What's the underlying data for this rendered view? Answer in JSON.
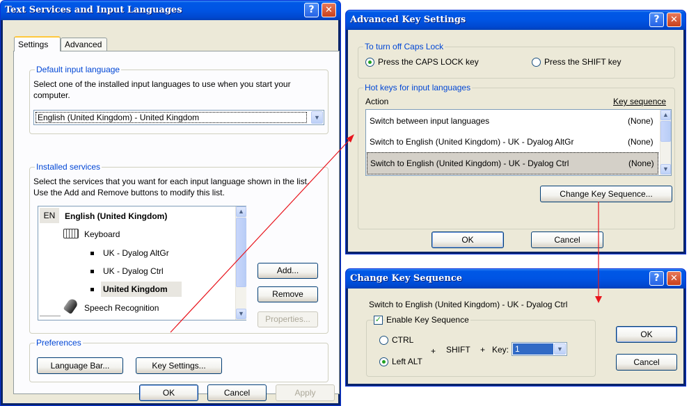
{
  "text_services": {
    "title": "Text Services and Input Languages",
    "tabs": [
      "Settings",
      "Advanced"
    ],
    "default_group": {
      "label": "Default input language",
      "description": "Select one of the installed input languages to use when you start your computer.",
      "selected": "English (United Kingdom) - United Kingdom"
    },
    "installed_group": {
      "label": "Installed services",
      "description": "Select the services that you want for each input language shown in the list. Use the Add and Remove buttons to modify this list.",
      "tree": {
        "lang_code": "EN",
        "language": "English (United Kingdom)",
        "keyboard": "Keyboard",
        "layouts": [
          "UK - Dyalog AltGr",
          "UK - Dyalog Ctrl",
          "United Kingdom"
        ],
        "speech": "Speech Recognition"
      },
      "add": "Add...",
      "remove": "Remove",
      "properties": "Properties..."
    },
    "preferences_group": {
      "label": "Preferences",
      "language_bar": "Language Bar...",
      "key_settings": "Key Settings..."
    },
    "ok": "OK",
    "cancel": "Cancel",
    "apply": "Apply"
  },
  "advanced_key": {
    "title": "Advanced Key Settings",
    "caps_group": {
      "label": "To turn off Caps Lock",
      "option1": "Press the CAPS LOCK key",
      "option2": "Press the SHIFT key"
    },
    "hotkeys_group": {
      "label": "Hot keys for input languages",
      "col_action": "Action",
      "col_sequence": "Key sequence",
      "rows": [
        {
          "action": "Switch between input languages",
          "sequence": "(None)"
        },
        {
          "action": "Switch to English (United Kingdom) - UK - Dyalog AltGr",
          "sequence": "(None)"
        },
        {
          "action": "Switch to English (United Kingdom) - UK - Dyalog Ctrl",
          "sequence": "(None)"
        }
      ],
      "change": "Change Key Sequence..."
    },
    "ok": "OK",
    "cancel": "Cancel"
  },
  "change_key": {
    "title": "Change Key Sequence",
    "subtitle": "Switch to English (United Kingdom) - UK - Dyalog Ctrl",
    "enable": "Enable Key Sequence",
    "ctrl": "CTRL",
    "left_alt": "Left ALT",
    "plus1": "+",
    "shift": "SHIFT",
    "plus2": "+",
    "key_label": "Key:",
    "key_value": "1",
    "ok": "OK",
    "cancel": "Cancel"
  },
  "colors": {
    "title_bar": "#0054e3",
    "client": "#ece9d8",
    "selection": "#316ac5",
    "arrow": "#e8141c"
  }
}
